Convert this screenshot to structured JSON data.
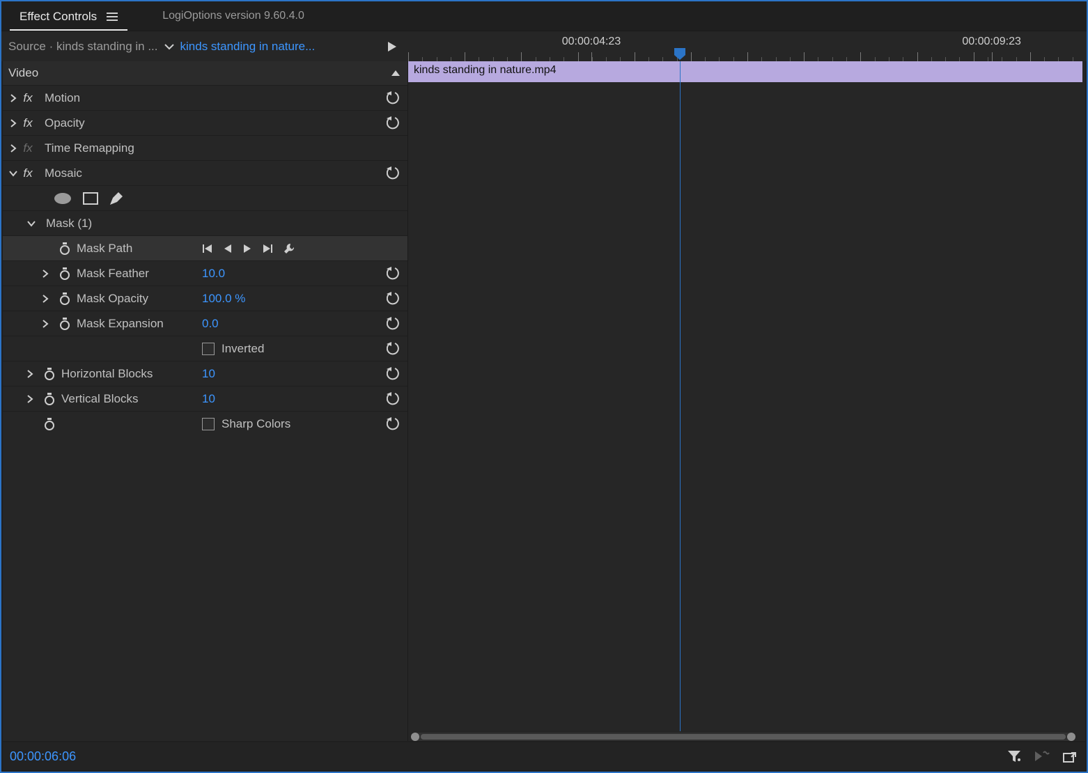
{
  "tabbar": {
    "active_tab": "Effect Controls"
  },
  "version": "LogiOptions version 9.60.4.0",
  "header": {
    "source_label": "Source · kinds standing in ...",
    "clip_label": "kinds standing in nature..."
  },
  "ruler": {
    "tc_left": "00:00:04:23",
    "tc_right": "00:00:09:23"
  },
  "playhead_percent": 40,
  "timeline": {
    "track_label": "kinds standing in nature.mp4"
  },
  "footer": {
    "timecode": "00:00:06:06"
  },
  "video_header": "Video",
  "effects": {
    "motion": "Motion",
    "opacity": "Opacity",
    "timeremap": "Time Remapping",
    "mosaic": "Mosaic",
    "mask_label": "Mask (1)",
    "mask_path": "Mask Path",
    "mask_feather_label": "Mask Feather",
    "mask_feather_value": "10.0",
    "mask_opacity_label": "Mask Opacity",
    "mask_opacity_value": "100.0 %",
    "mask_expansion_label": "Mask Expansion",
    "mask_expansion_value": "0.0",
    "inverted_label": "Inverted",
    "hblocks_label": "Horizontal Blocks",
    "hblocks_value": "10",
    "vblocks_label": "Vertical Blocks",
    "vblocks_value": "10",
    "sharp_colors_label": "Sharp Colors"
  }
}
